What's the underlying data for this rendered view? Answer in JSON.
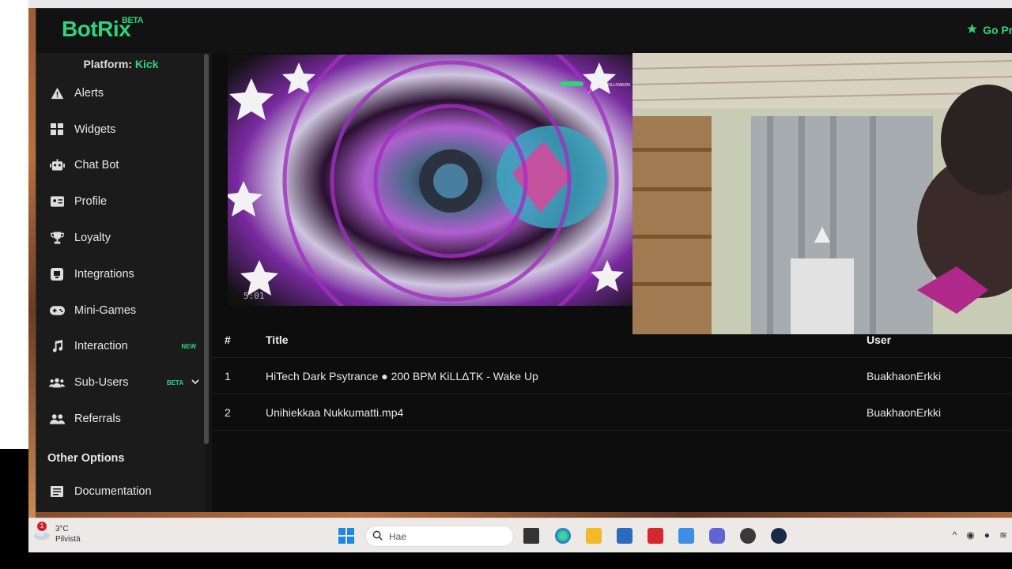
{
  "app": {
    "logo": "BotRix",
    "logo_badge": "BETA",
    "premium_label": "Go Pre"
  },
  "sidebar": {
    "platform_label": "Platform:",
    "platform_value": "Kick",
    "items": [
      {
        "label": "Alerts",
        "icon": "warning-icon"
      },
      {
        "label": "Widgets",
        "icon": "grid-icon"
      },
      {
        "label": "Chat Bot",
        "icon": "robot-icon"
      },
      {
        "label": "Profile",
        "icon": "id-card-icon"
      },
      {
        "label": "Loyalty",
        "icon": "trophy-icon"
      },
      {
        "label": "Integrations",
        "icon": "integration-icon"
      },
      {
        "label": "Mini-Games",
        "icon": "gamepad-icon"
      },
      {
        "label": "Interaction",
        "icon": "music-icon",
        "badge": "NEW"
      },
      {
        "label": "Sub-Users",
        "icon": "users-icon",
        "badge": "BETA"
      },
      {
        "label": "Referrals",
        "icon": "people-icon"
      }
    ],
    "other_options": "Other Options",
    "documentation": "Documentation"
  },
  "player": {
    "time": "5:01",
    "overlay_text": "FOLLOWERS"
  },
  "table": {
    "headers": [
      "#",
      "Title",
      "User"
    ],
    "rows": [
      {
        "num": "1",
        "title": "HiTech Dark Psytrance ● 200 BPM KiLLΔTK - Wake Up",
        "user": "BuakhaonErkki"
      },
      {
        "num": "2",
        "title": "Unihiekkaa Nukkumatti.mp4",
        "user": "BuakhaonErkki"
      }
    ]
  },
  "taskbar": {
    "weather_badge": "1",
    "temperature": "3°C",
    "weather_desc": "Pilvistä",
    "search_placeholder": "Hae"
  },
  "colors": {
    "accent": "#2fd37a",
    "sidebar_bg": "#1b1b1b",
    "main_bg": "#0d0d0d"
  }
}
